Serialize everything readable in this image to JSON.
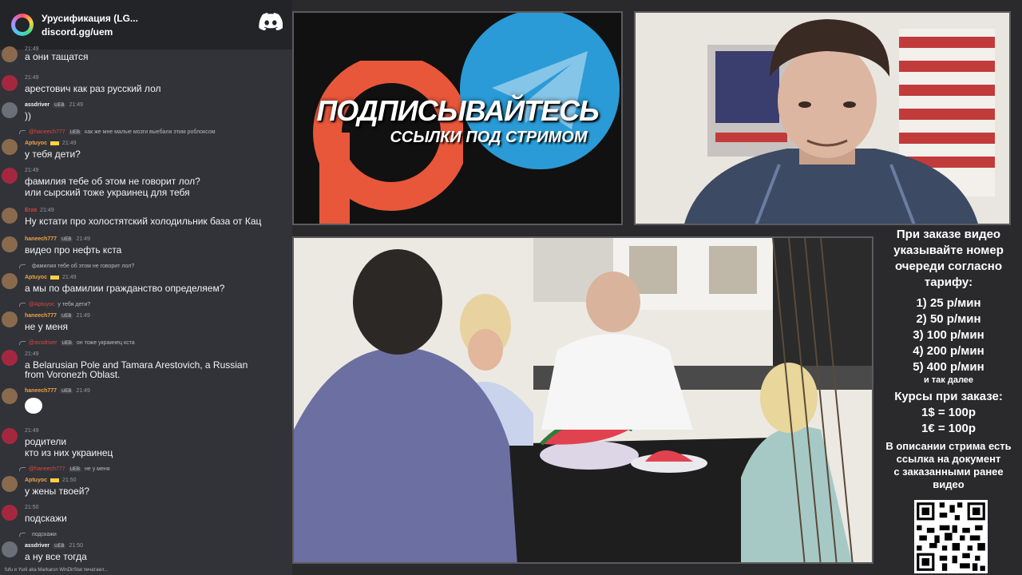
{
  "chat": {
    "server_name": "Урусификация (LG...",
    "server_link": "discord.gg/uem",
    "messages": [
      {
        "user": "",
        "time": "21:49",
        "text": "а они тащатся"
      },
      {
        "user": "",
        "time": "21:49",
        "text": "арестович как раз русский лол"
      },
      {
        "user": "assdriver",
        "badge": "UEB",
        "time": "21:49",
        "text": "))"
      },
      {
        "reply_user": "@haneech777",
        "reply_badge": "UEB",
        "reply_text": "как же мне малые мозги выебали этим роблоксом",
        "user": "Aptuyoc",
        "time": "21:49",
        "text": "у тебя дети?"
      },
      {
        "user": "",
        "time": "21:49",
        "text": "фамилия тебе об этом не говорит лол?",
        "text2": "или сырский тоже украинец для тебя"
      },
      {
        "user": "Erzo",
        "time": "21:49",
        "text": "Ну кстати про холостятский холодильник база от Кац"
      },
      {
        "user": "haneech777",
        "badge": "UEB",
        "time": "21:49",
        "text": "видео про нефть кста"
      },
      {
        "reply_user": "",
        "reply_text": "фамилия тебе об этом не говорит лол?",
        "user": "Aptuyoc",
        "time": "21:49",
        "text": "а мы по фамилии гражданство определяем?"
      },
      {
        "reply_user": "@Aptuyoc",
        "reply_text": "у тебя дети?",
        "user": "haneech777",
        "badge": "UEB",
        "time": "21:49",
        "text": "не у меня"
      },
      {
        "reply_user": "@assdriver",
        "reply_badge": "UEB",
        "reply_text": "он тоже украинец кста",
        "user": "",
        "time": "21:49",
        "text": "a Belarusian Pole and Tamara Arestovich, a Russian",
        "text2": "from Voronezh Oblast."
      },
      {
        "user": "haneech777",
        "badge": "UEB",
        "time": "21:49",
        "text": ""
      },
      {
        "user": "",
        "time": "21:49",
        "text": "родители",
        "text2": "кто из них украинец"
      },
      {
        "reply_user": "@haneech777",
        "reply_badge": "UEB",
        "reply_text": "не у меня",
        "user": "Aptuyoc",
        "time": "21:50",
        "text": "у жены твоей?"
      },
      {
        "user": "",
        "time": "21:50",
        "text": "подскажи"
      },
      {
        "reply_user": "",
        "reply_text": "подскажи",
        "user": "assdriver",
        "badge": "UEB",
        "time": "21:50",
        "text": "а ну все тогда"
      }
    ],
    "typing": "fufu и Yurii aka Markarun WinDirStat печатают..."
  },
  "promo": {
    "title": "ПОДПИСЫВАЙТЕСЬ",
    "subtitle": "ССЫЛКИ ПОД СТРИМОМ"
  },
  "info": {
    "header": [
      "При заказе видео",
      "указывайте номер",
      "очереди согласно",
      "тарифу:"
    ],
    "tariffs": [
      "1) 25 р/мин",
      "2) 50 р/мин",
      "3) 100 р/мин",
      "4) 200 р/мин",
      "5) 400 р/мин"
    ],
    "etc": "и так далее",
    "rates_title": "Курсы при заказе:",
    "rates": [
      "1$ = 100р",
      "1€ = 100р"
    ],
    "desc": [
      "В описании стрима есть",
      "ссылка на документ",
      "с заказанными ранее",
      "видео"
    ]
  },
  "colors": {
    "chat_bg": "#313338",
    "header_bg": "#232428",
    "page_bg": "#2a2a2d",
    "telegram_blue": "#2a9bd6",
    "patreon_orange": "#e8573a"
  }
}
